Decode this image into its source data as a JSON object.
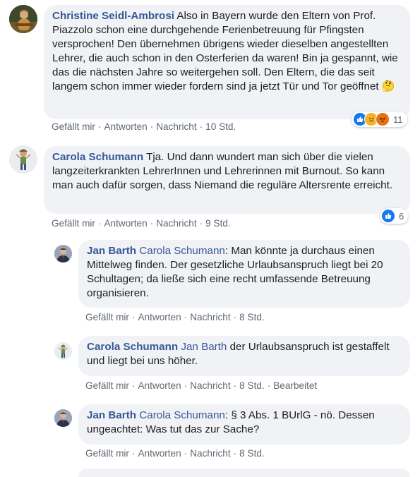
{
  "comments": [
    {
      "author": "Christine Seidl-Ambrosi",
      "text": "Also in Bayern wurde den Eltern von Prof. Piazzolo schon eine durchgehende Ferienbetreuung für Pfingsten versprochen! Den übernehmen übrigens wieder dieselben angestellten Lehrer, die auch schon in den Osterferien da waren! Bin ja gespannt, wie das die nächsten Jahre so weitergehen soll. Den Eltern, die das seit langem schon immer wieder fordern sind ja jetzt Tür und Tor geöffnet",
      "emoji": "🤔",
      "like": "Gefällt mir",
      "reply": "Antworten",
      "message": "Nachricht",
      "time": "10 Std.",
      "reaction_count": "11",
      "reaction_icons": [
        "like-icon",
        "sad-icon",
        "angry-icon"
      ]
    },
    {
      "author": "Carola Schumann",
      "text": "Tja. Und dann wundert man sich über die vielen langzeiterkrankten LehrerInnen und Lehrerinnen mit Burnout. So kann man auch dafür sorgen, dass Niemand die reguläre Altersrente erreicht.",
      "like": "Gefällt mir",
      "reply": "Antworten",
      "message": "Nachricht",
      "time": "9 Std.",
      "reaction_count": "6",
      "reaction_icons": [
        "like-icon"
      ]
    }
  ],
  "replies": [
    {
      "author": "Jan Barth",
      "mention": "Carola Schumann",
      "text": ": Man könnte ja durchaus einen Mittelweg finden. Der gesetzliche Urlaubsanspruch liegt bei 20 Schultagen; da ließe sich eine recht umfassende Betreuung organisieren.",
      "like": "Gefällt mir",
      "reply": "Antworten",
      "message": "Nachricht",
      "time": "8 Std."
    },
    {
      "author": "Carola Schumann",
      "mention": "Jan Barth",
      "text": " der Urlaubsanspruch ist gestaffelt und liegt bei uns höher.",
      "like": "Gefällt mir",
      "reply": "Antworten",
      "message": "Nachricht",
      "time": "8 Std.",
      "edited": "Bearbeitet"
    },
    {
      "author": "Jan Barth",
      "mention": "Carola Schumann",
      "text": ": § 3 Abs. 1 BUrlG - nö. Dessen ungeachtet: Was tut das zur Sache?",
      "like": "Gefällt mir",
      "reply": "Antworten",
      "message": "Nachricht",
      "time": "8 Std."
    }
  ],
  "colors": {
    "author": "#365899",
    "bubble": "#f0f2f5",
    "meta": "#606770",
    "like": "#1877f2",
    "sad": "#f7b125",
    "angry": "#e9710f"
  }
}
